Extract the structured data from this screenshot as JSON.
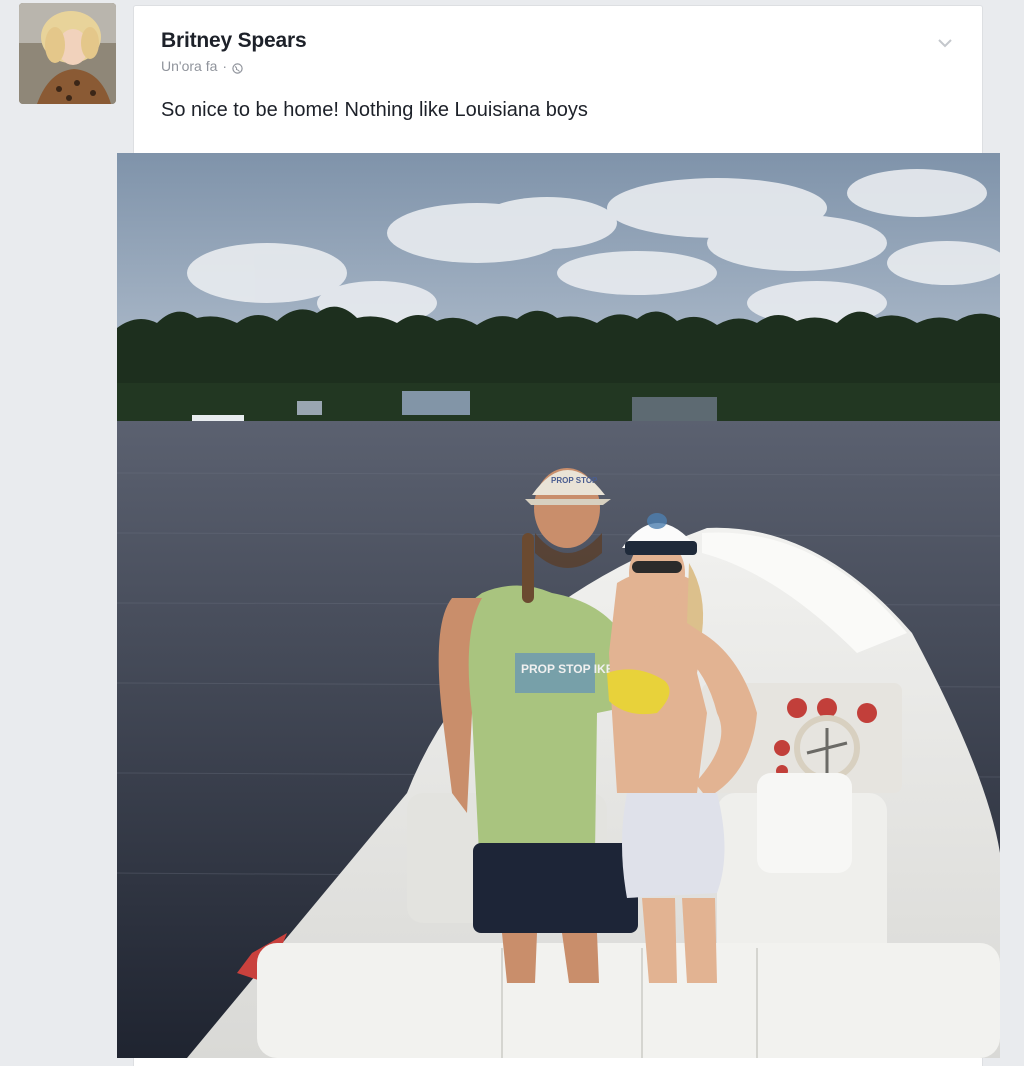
{
  "post": {
    "author_name": "Britney Spears",
    "timestamp": "Un'ora fa",
    "separator": "·",
    "text": "So nice to be home! Nothing like Louisiana boys",
    "privacy_icon": "globe-icon",
    "options_icon": "chevron-down-icon"
  },
  "photo": {
    "hat_text": "PROP STOP",
    "shirt_text": "PROP STOP IKE"
  },
  "colors": {
    "background": "#e9ebee",
    "card": "#ffffff",
    "name": "#1d2129",
    "meta": "#90949c"
  }
}
